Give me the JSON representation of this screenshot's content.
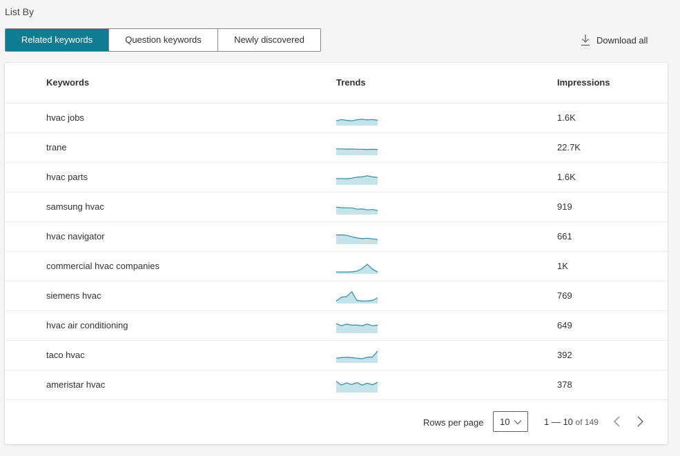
{
  "header": {
    "list_by_label": "List By"
  },
  "tabs": [
    {
      "label": "Related keywords",
      "active": true
    },
    {
      "label": "Question keywords",
      "active": false
    },
    {
      "label": "Newly discovered",
      "active": false
    }
  ],
  "download": {
    "label": "Download all",
    "icon": "download-icon"
  },
  "table": {
    "columns": [
      "Keywords",
      "Trends",
      "Impressions"
    ],
    "rows": [
      {
        "keyword": "hvac jobs",
        "impressions": "1.6K",
        "trend": [
          0.3,
          0.42,
          0.35,
          0.3,
          0.4,
          0.45,
          0.38,
          0.42,
          0.35
        ]
      },
      {
        "keyword": "trane",
        "impressions": "22.7K",
        "trend": [
          0.45,
          0.45,
          0.43,
          0.44,
          0.42,
          0.42,
          0.4,
          0.41,
          0.4
        ]
      },
      {
        "keyword": "hvac parts",
        "impressions": "1.6K",
        "trend": [
          0.45,
          0.45,
          0.43,
          0.48,
          0.58,
          0.6,
          0.7,
          0.6,
          0.55
        ]
      },
      {
        "keyword": "samsung hvac",
        "impressions": "919",
        "trend": [
          0.55,
          0.5,
          0.48,
          0.48,
          0.36,
          0.38,
          0.3,
          0.33,
          0.25
        ]
      },
      {
        "keyword": "hvac navigator",
        "impressions": "661",
        "trend": [
          0.72,
          0.72,
          0.68,
          0.55,
          0.45,
          0.38,
          0.42,
          0.36,
          0.3
        ]
      },
      {
        "keyword": "commercial hvac companies",
        "impressions": "1K",
        "trend": [
          0.05,
          0.05,
          0.05,
          0.06,
          0.12,
          0.35,
          0.75,
          0.3,
          0.05
        ]
      },
      {
        "keyword": "siemens hvac",
        "impressions": "769",
        "trend": [
          0.1,
          0.45,
          0.5,
          0.95,
          0.15,
          0.1,
          0.12,
          0.15,
          0.4
        ]
      },
      {
        "keyword": "hvac air conditioning",
        "impressions": "649",
        "trend": [
          0.75,
          0.55,
          0.7,
          0.6,
          0.62,
          0.55,
          0.7,
          0.55,
          0.6
        ]
      },
      {
        "keyword": "taco hvac",
        "impressions": "392",
        "trend": [
          0.3,
          0.35,
          0.38,
          0.35,
          0.3,
          0.25,
          0.38,
          0.4,
          0.95
        ]
      },
      {
        "keyword": "ameristar hvac",
        "impressions": "378",
        "trend": [
          0.9,
          0.55,
          0.75,
          0.6,
          0.78,
          0.55,
          0.72,
          0.58,
          0.8
        ]
      }
    ]
  },
  "pagination": {
    "rows_per_page_label": "Rows per page",
    "rows_per_page_value": "10",
    "range": "1 — 10",
    "of_total": "of 149"
  },
  "colors": {
    "accent": "#0f7c94",
    "spark_line": "#2a8da3",
    "spark_fill": "#c5e3e9"
  }
}
